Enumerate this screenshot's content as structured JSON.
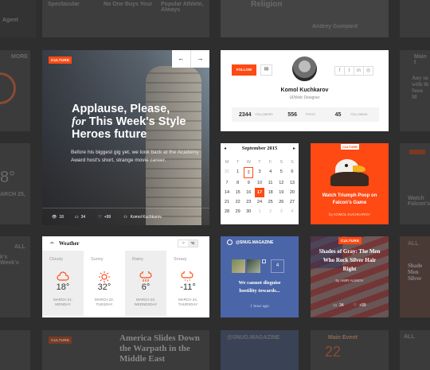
{
  "bg": {
    "top": [
      "Spectacular",
      "No One Buys Your",
      "Popular Athlete, Always"
    ],
    "top2": [
      "Agent",
      "Religion",
      "Andrey Gumpard"
    ],
    "left": [
      "MORE",
      "8°",
      "ARCH 25,",
      "ALL",
      "k's Week's",
      "ore"
    ],
    "bottom": [
      "CULTURE",
      "America Slides Down the Warpath in the Middle East",
      "@SNUG.MAGAZINE",
      "Main Event",
      "22",
      "ALL"
    ],
    "right": [
      "Main t",
      "Any su with th Seen M",
      "Watch Falcon's",
      "ALL",
      "Shade Men Silver",
      "CULTURE"
    ]
  },
  "hero": {
    "tag": "CULTURE",
    "prev": "←",
    "next": "→",
    "title_line1": "Applause, Please,",
    "title_for": "for",
    "title_line2": " This Week's Style",
    "title_line3": "Heroes future",
    "excerpt": "Before his biggest gig yet, we look back at the Academy Award host's short, strange movie career.",
    "views": "18",
    "comments": "34",
    "likes": "+99",
    "author": "Komol Kuchkarov"
  },
  "profile": {
    "follow": "FOLLOW",
    "name": "Komol Kuchkarov",
    "role": "UI/Web Designer",
    "stats": [
      {
        "value": "2344",
        "label": "FOLLOWERS"
      },
      {
        "value": "556",
        "label": "POSTS"
      },
      {
        "value": "45",
        "label": "FOLLOWING"
      }
    ],
    "socials": [
      "f",
      "t",
      "in",
      "◎"
    ]
  },
  "calendar": {
    "title": "September 2015",
    "days": [
      "M",
      "T",
      "W",
      "T",
      "F",
      "S",
      "S"
    ],
    "weeks": [
      [
        "31",
        "1",
        "2",
        "3",
        "4",
        "5",
        "6"
      ],
      [
        "7",
        "8",
        "9",
        "10",
        "11",
        "12",
        "13"
      ],
      [
        "14",
        "15",
        "16",
        "17",
        "18",
        "19",
        "20"
      ],
      [
        "21",
        "22",
        "23",
        "24",
        "25",
        "26",
        "27"
      ],
      [
        "28",
        "29",
        "30",
        "1",
        "2",
        "3",
        "4"
      ]
    ],
    "selected": "17"
  },
  "promo": {
    "tag": "CULTURE",
    "title": "Watch Triumph Poop on Falcon's Game",
    "byline": "by KOMOL KUCHKAROV"
  },
  "weather": {
    "title": "Weather",
    "unit_f": "°F",
    "unit_c": "°C",
    "days": [
      {
        "name": "Cloudy",
        "temp": "18°",
        "date": "MARCH 21,",
        "day": "MONDAY"
      },
      {
        "name": "Sunny",
        "temp": "32°",
        "date": "MARCH 22,",
        "day": "TUESDAY"
      },
      {
        "name": "Rainy",
        "temp": "6°",
        "date": "MARCH 23,",
        "day": "WEDNESDAY"
      },
      {
        "name": "Snowy",
        "temp": "-11°",
        "date": "MARCH 24,",
        "day": "THURSDAY"
      }
    ]
  },
  "social": {
    "handle": "@SNUG.MAGAZINE",
    "count": "4",
    "text": "We cannot disguise hostility towards...",
    "time": "1 hour ago"
  },
  "flag": {
    "tag": "CULTURE",
    "title": "Shades of Gray: The Men Who Rock Silver Hair Right",
    "byline": "by AMIR ALIMOV",
    "comments": "34",
    "likes": "+99"
  },
  "colors": {
    "accent": "#ff4a14",
    "blue": "#4a66a8"
  }
}
